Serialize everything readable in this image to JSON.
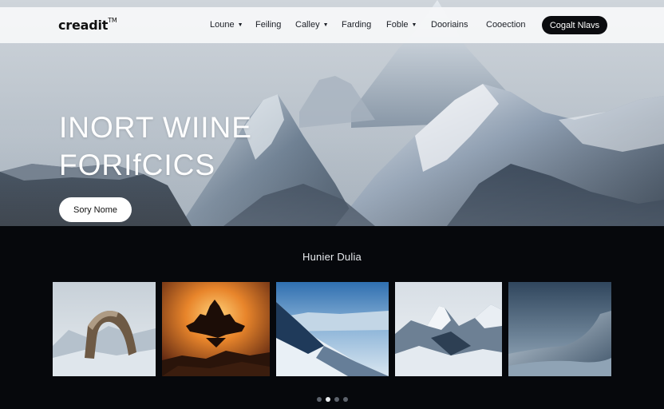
{
  "brand": {
    "name": "creadit",
    "mark": "TM"
  },
  "nav": {
    "items": [
      {
        "label": "Loune",
        "caret": true
      },
      {
        "label": "Feiling",
        "caret": false
      },
      {
        "label": "Calley",
        "caret": true
      },
      {
        "label": "Farding",
        "caret": false
      },
      {
        "label": "Foble",
        "caret": true
      },
      {
        "label": "Dooriains",
        "caret": false
      },
      {
        "label": "Cooection",
        "caret": false
      }
    ],
    "cta_label": "Cogalt Nlavs"
  },
  "hero": {
    "title_line1": "INORT WIINE",
    "title_line2": "FORIfCICS",
    "button_label": "Sory Nome"
  },
  "gallery": {
    "title": "Hunier Dulia",
    "thumbnails": [
      {
        "subject": "rock-arch-in-snow"
      },
      {
        "subject": "floating-temple-sunset"
      },
      {
        "subject": "snowy-slope-blue-sky"
      },
      {
        "subject": "snowy-peak-mist"
      },
      {
        "subject": "dark-snow-dunes"
      }
    ],
    "pagination": {
      "count": 4,
      "active_index": 1
    }
  },
  "colors": {
    "navbar_bg": "#f6f7f9",
    "cta_bg": "#0b0c0f",
    "dark_bg": "#06080c",
    "dot_active": "#e9ecef",
    "dot_inactive": "#5d636c"
  }
}
